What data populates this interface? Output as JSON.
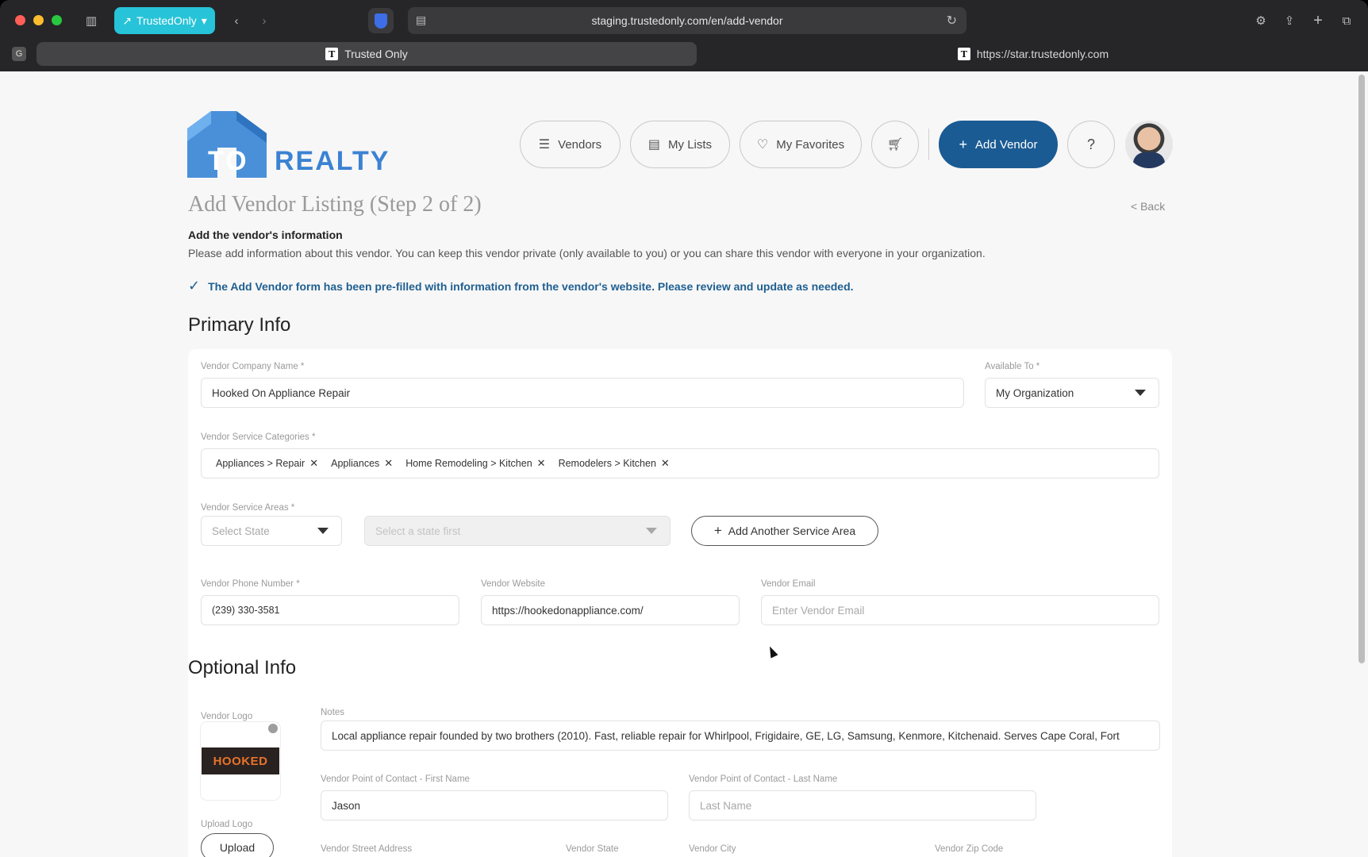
{
  "browser": {
    "profile_label": "TrustedOnly",
    "url": "staging.trustedonly.com/en/add-vendor",
    "tabs": [
      {
        "title": "Trusted Only"
      },
      {
        "title": "https://star.trustedonly.com"
      }
    ]
  },
  "header": {
    "logo_text_1": "TO",
    "logo_text_2": "REALTY",
    "nav": {
      "vendors": "Vendors",
      "my_lists": "My Lists",
      "my_favorites": "My Favorites",
      "add_vendor": "Add Vendor",
      "help": "?"
    }
  },
  "page": {
    "title": "Add Vendor Listing (Step 2 of 2)",
    "back": "< Back",
    "subtitle": "Add the vendor's information",
    "description": "Please add information about this vendor. You can keep this vendor private (only available to you) or you can share this vendor with everyone in your organization.",
    "notice": "The Add Vendor form has been pre-filled with information from the vendor's website. Please review and update as needed."
  },
  "primary": {
    "heading": "Primary Info",
    "company_name_label": "Vendor Company Name *",
    "company_name_value": "Hooked On Appliance Repair",
    "available_to_label": "Available To *",
    "available_to_value": "My Organization",
    "categories_label": "Vendor Service Categories *",
    "categories": [
      "Appliances > Repair",
      "Appliances",
      "Home Remodeling > Kitchen",
      "Remodelers > Kitchen"
    ],
    "service_areas_label": "Vendor Service Areas *",
    "state_placeholder": "Select State",
    "area_placeholder": "Select a state first",
    "add_area_label": "Add Another Service Area",
    "phone_label": "Vendor Phone Number *",
    "phone_value": "(239) 330-3581",
    "website_label": "Vendor Website",
    "website_value": "https://hookedonappliance.com/",
    "email_label": "Vendor Email",
    "email_placeholder": "Enter Vendor Email"
  },
  "optional": {
    "heading": "Optional Info",
    "logo_label": "Vendor Logo",
    "logo_image_text": "HOOKED",
    "upload_logo_label": "Upload Logo",
    "upload_button": "Upload",
    "notes_label": "Notes",
    "notes_value": "Local appliance repair founded by two brothers (2010). Fast, reliable repair for Whirlpool, Frigidaire, GE, LG, Samsung, Kenmore, Kitchenaid. Serves Cape Coral, Fort",
    "first_name_label": "Vendor Point of Contact - First Name",
    "first_name_value": "Jason",
    "last_name_label": "Vendor Point of Contact - Last Name",
    "last_name_placeholder": "Last Name",
    "street_label": "Vendor Street Address",
    "state_label": "Vendor State",
    "city_label": "Vendor City",
    "zip_label": "Vendor Zip Code"
  }
}
